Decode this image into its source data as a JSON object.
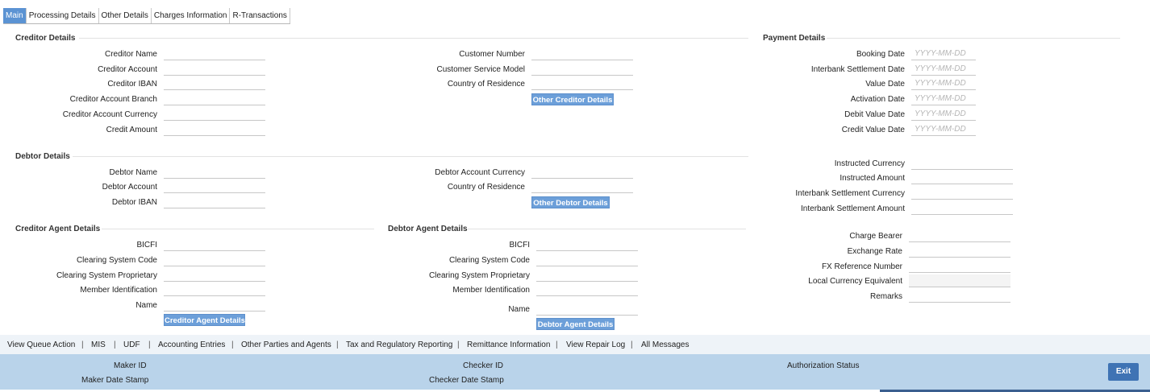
{
  "tabs": [
    "Main",
    "Processing Details",
    "Other Details",
    "Charges Information",
    "R-Transactions"
  ],
  "creditor": {
    "title": "Creditor Details",
    "labels": [
      "Creditor Name",
      "Creditor Account",
      "Creditor IBAN",
      "Creditor Account Branch",
      "Creditor Account Currency",
      "Credit Amount"
    ],
    "right_labels": [
      "Customer Number",
      "Customer Service Model",
      "Country of Residence"
    ],
    "button": "Other Creditor Details"
  },
  "debtor": {
    "title": "Debtor Details",
    "labels": [
      "Debtor Name",
      "Debtor Account",
      "Debtor IBAN"
    ],
    "right_labels": [
      "Debtor Account Currency",
      "Country of Residence"
    ],
    "button": "Other Debtor Details"
  },
  "creditor_agent": {
    "title": "Creditor Agent Details",
    "labels": [
      "BICFI",
      "Clearing System Code",
      "Clearing System Proprietary",
      "Member Identification",
      "Name"
    ],
    "button": "Creditor Agent Details"
  },
  "debtor_agent": {
    "title": "Debtor Agent Details",
    "labels": [
      "BICFI",
      "Clearing System Code",
      "Clearing System Proprietary",
      "Member Identification",
      "Name"
    ],
    "button": "Debtor Agent Details"
  },
  "payment": {
    "title": "Payment Details",
    "date_labels": [
      "Booking Date",
      "Interbank Settlement Date",
      "Value Date",
      "Activation Date",
      "Debit Value Date",
      "Credit Value Date"
    ],
    "date_placeholder": "YYYY-MM-DD",
    "amount_labels": [
      "Instructed Currency",
      "Instructed Amount",
      "Interbank Settlement Currency",
      "Interbank Settlement Amount"
    ],
    "charge_labels": [
      "Charge Bearer",
      "Exchange Rate",
      "FX Reference Number",
      "Local Currency Equivalent",
      "Remarks"
    ]
  },
  "links": [
    "View Queue Action",
    "MIS",
    "UDF",
    "Accounting Entries",
    "Other Parties and Agents",
    "Tax and Regulatory Reporting",
    "Remittance Information",
    "View Repair Log",
    "All Messages"
  ],
  "footer": {
    "maker_id": "Maker ID",
    "maker_date": "Maker Date Stamp",
    "checker_id": "Checker ID",
    "checker_date": "Checker Date Stamp",
    "auth_status": "Authorization Status",
    "exit": "Exit"
  }
}
